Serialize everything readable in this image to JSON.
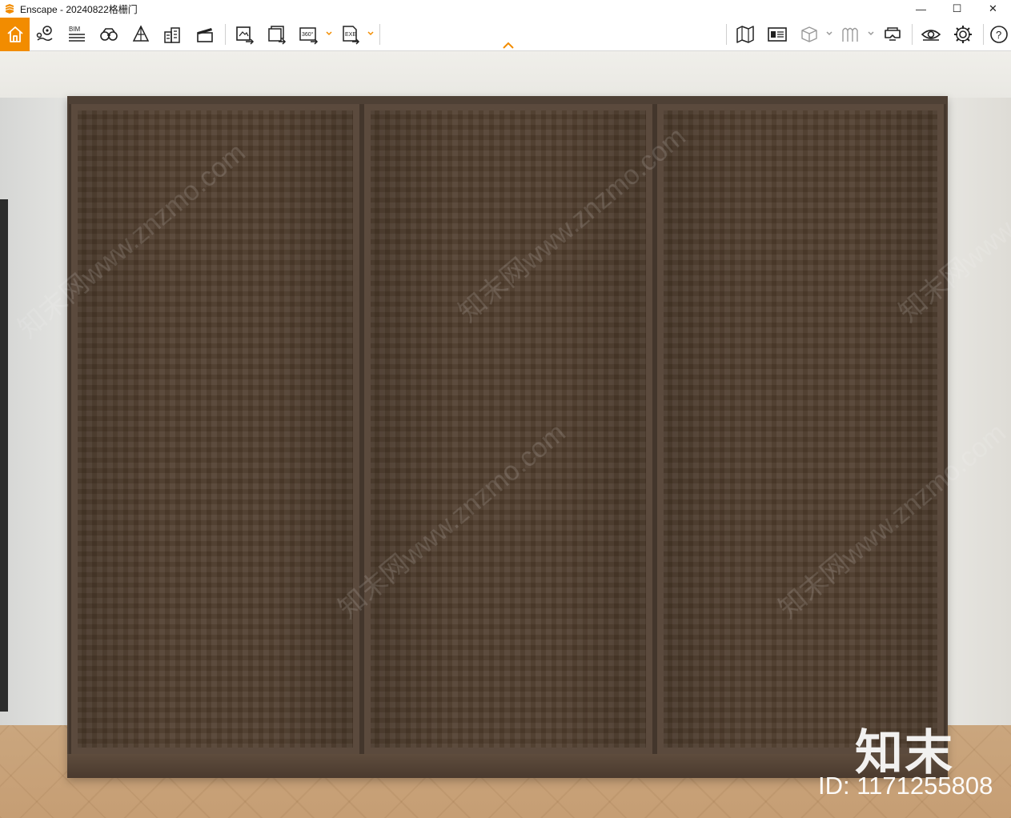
{
  "window": {
    "title": "Enscape - 20240822格栅门",
    "minimize_icon": "minimize-icon",
    "maximize_icon": "maximize-icon",
    "close_icon": "close-icon",
    "controls": {
      "minimize": "—",
      "maximize": "☐",
      "close": "✕"
    }
  },
  "toolbar": {
    "accent_color": "#f28c00",
    "left_buttons": [
      {
        "id": "home",
        "icon": "home-icon"
      },
      {
        "id": "location",
        "icon": "map-pin-icon"
      },
      {
        "id": "bim",
        "icon": "bim-icon",
        "label": "BIM"
      },
      {
        "id": "binoculars",
        "icon": "binoculars-icon"
      },
      {
        "id": "perspective",
        "icon": "perspective-icon"
      },
      {
        "id": "buildings",
        "icon": "buildings-icon"
      },
      {
        "id": "clapperboard",
        "icon": "clapperboard-icon"
      }
    ],
    "export_buttons": [
      {
        "id": "render-image",
        "icon": "export-image-icon"
      },
      {
        "id": "batch-render",
        "icon": "batch-render-icon"
      },
      {
        "id": "export-360",
        "icon": "export-360-icon",
        "label": "360°"
      },
      {
        "id": "export-exe",
        "icon": "export-exe-icon",
        "label": "EXE"
      }
    ],
    "right_buttons": [
      {
        "id": "map",
        "icon": "map-icon"
      },
      {
        "id": "visual-settings",
        "icon": "visual-settings-icon"
      },
      {
        "id": "asset-library",
        "icon": "cube-icon"
      },
      {
        "id": "materials",
        "icon": "materials-icon"
      },
      {
        "id": "vr",
        "icon": "vr-headset-icon"
      },
      {
        "id": "view",
        "icon": "eye-icon"
      },
      {
        "id": "settings",
        "icon": "gear-icon"
      },
      {
        "id": "help",
        "icon": "help-icon",
        "label": "?"
      }
    ],
    "collapse_icon": "chevron-up-icon"
  },
  "viewport": {
    "scene": "rendered interior with wooden lattice sliding door panels",
    "watermark_logo": "知末",
    "watermark_id": "ID: 1171255808",
    "watermark_repeat": "知末网www.znzmo.com"
  }
}
